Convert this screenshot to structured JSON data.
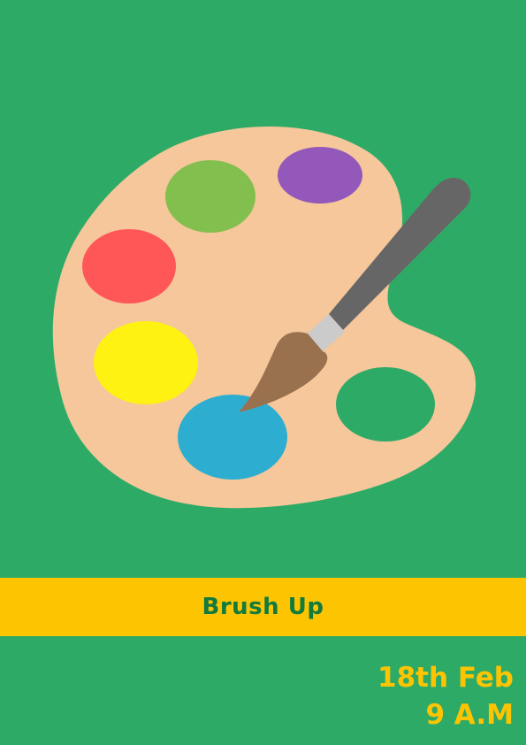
{
  "poster": {
    "title": "Brush Up",
    "date": "18th Feb",
    "time": "9 A.M"
  },
  "colors": {
    "background": "#2eaa67",
    "palette": "#f5c79a",
    "banner": "#fdc402",
    "title_text": "#127a3c",
    "info_text": "#fdc402",
    "paint_green": "#83bf4f",
    "paint_purple": "#9358ba",
    "paint_red": "#ff5757",
    "paint_yellow": "#fdf212",
    "paint_blue": "#2daed1",
    "brush_handle": "#666666",
    "brush_ferrule": "#cbcbcb",
    "brush_bristles": "#99714e"
  },
  "illustration": {
    "icons": [
      "palette-icon",
      "paintbrush-icon"
    ]
  }
}
